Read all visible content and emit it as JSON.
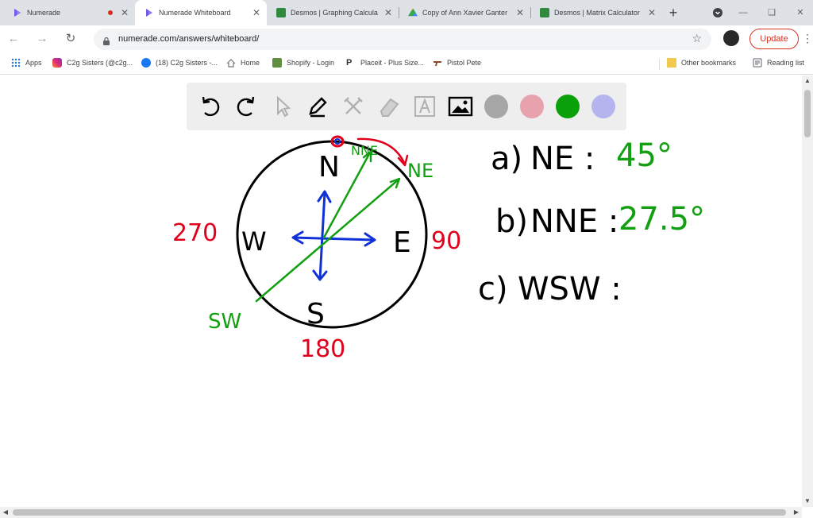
{
  "tabs": [
    {
      "title": "Numerade",
      "recording": true,
      "active": false
    },
    {
      "title": "Numerade Whiteboard",
      "recording": false,
      "active": true
    },
    {
      "title": "Desmos | Graphing Calcula",
      "recording": false,
      "active": false
    },
    {
      "title": "Copy of Ann Xavier Ganter",
      "recording": false,
      "active": false
    },
    {
      "title": "Desmos | Matrix Calculator",
      "recording": false,
      "active": false
    }
  ],
  "address": {
    "url": "numerade.com/answers/whiteboard/"
  },
  "update_label": "Update",
  "bookmarks": {
    "items": [
      {
        "label": "Apps",
        "icon": "apps-grid-icon"
      },
      {
        "label": "C2g Sisters (@c2g...",
        "icon": "instagram-icon"
      },
      {
        "label": "(18) C2g Sisters -...",
        "icon": "facebook-icon"
      },
      {
        "label": "Home",
        "icon": "home-icon"
      },
      {
        "label": "Shopify - Login",
        "icon": "shopify-icon"
      },
      {
        "label": "Placeit - Plus Size...",
        "icon": "placeit-icon"
      },
      {
        "label": "Pistol Pete",
        "icon": "pistol-icon"
      }
    ],
    "other": "Other bookmarks",
    "reading": "Reading list"
  },
  "whiteboard": {
    "tools": [
      "undo-icon",
      "redo-icon",
      "select-icon",
      "pen-icon",
      "tools-icon",
      "eraser-icon",
      "text-icon",
      "image-icon",
      "color-gray",
      "color-pink",
      "color-green",
      "color-lavender"
    ],
    "colors": {
      "gray": "#a6a6a6",
      "pink": "#e8a2ae",
      "green": "#0aa00a",
      "lavender": "#b4b4ee",
      "ink_red": "#e0001b",
      "ink_green": "#12a012",
      "ink_blue": "#1030d8"
    },
    "drawing": {
      "compass": {
        "north": "N",
        "east": "E",
        "south": "S",
        "west": "W"
      },
      "degree_labels": {
        "north": "0",
        "east": "90",
        "south": "180",
        "west": "270"
      },
      "direction_labels": {
        "nne": "NNE",
        "ne": "NE",
        "sw": "SW"
      },
      "answers": [
        {
          "part": "a)",
          "label": "NE :",
          "value": "45°"
        },
        {
          "part": "b)",
          "label": "NNE :",
          "value": "27.5°"
        },
        {
          "part": "c)",
          "label": "WSW :",
          "value": ""
        }
      ]
    }
  }
}
